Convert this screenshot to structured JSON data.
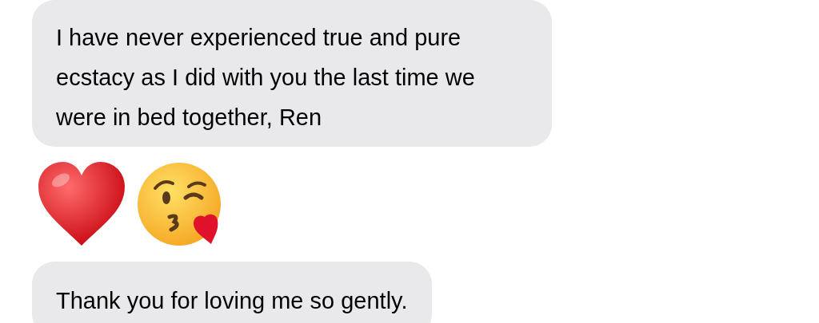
{
  "messages": [
    {
      "kind": "text",
      "text": "I have never experienced true and pure ecstacy as I did with you the last time we were in bed together, Ren"
    },
    {
      "kind": "emoji",
      "items": [
        {
          "kind": "heart"
        },
        {
          "kind": "kiss"
        }
      ]
    },
    {
      "kind": "text",
      "text": "Thank you for loving me so gently."
    }
  ]
}
